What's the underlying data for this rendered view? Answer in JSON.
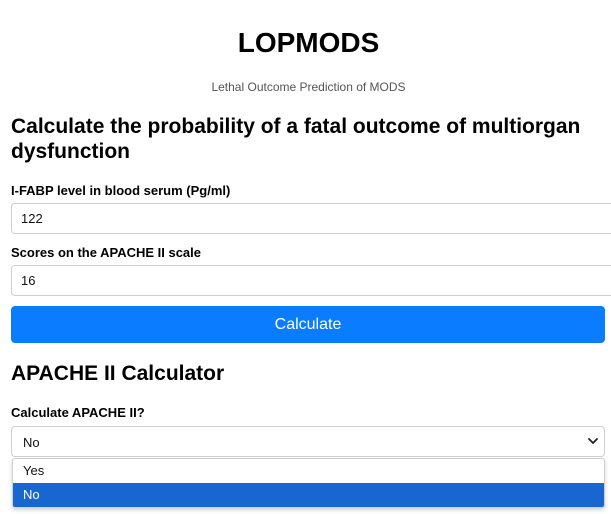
{
  "header": {
    "title": "LOPMODS",
    "subtitle": "Lethal Outcome Prediction of MODS"
  },
  "calculator": {
    "heading": "Calculate the probability of a fatal outcome of multiorgan dysfunction",
    "fabp_label": "I-FABP level in blood serum (Pg/ml)",
    "fabp_value": "122",
    "apache_label": "Scores on the APACHE II scale",
    "apache_value": "16",
    "button_label": "Calculate"
  },
  "apache_section": {
    "heading": "APACHE II Calculator",
    "select_label": "Calculate APACHE II?",
    "selected_value": "No",
    "options": [
      "Yes",
      "No"
    ]
  },
  "icons": {
    "dropdown": "chevron-down-icon"
  },
  "colors": {
    "primary_button": "#0a7cff",
    "option_highlight": "#1a66d0"
  }
}
